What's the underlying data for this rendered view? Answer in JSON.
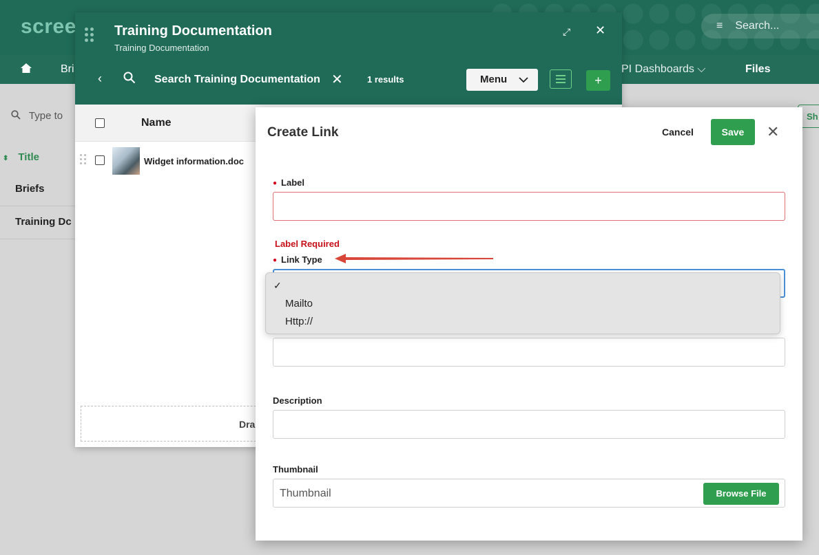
{
  "background": {
    "logo": "scree",
    "search_placeholder": "Search...",
    "nav": {
      "home_icon": "home-icon",
      "bri": "Bri",
      "kpi": "PI Dashboards",
      "files": "Files"
    },
    "filter_placeholder": "Type to",
    "show_button": "Sh",
    "column_title": "Title",
    "rows": [
      "Briefs",
      "Training Dc"
    ]
  },
  "window": {
    "title": "Training Documentation",
    "subtitle": "Training Documentation",
    "search_text": "Search Training Documentation",
    "results": "1 results",
    "menu_label": "Menu",
    "column_name": "Name",
    "file_name": "Widget information.doc",
    "drop_text": "Dra"
  },
  "dialog": {
    "title": "Create Link",
    "cancel_label": "Cancel",
    "save_label": "Save",
    "label_field": "Label",
    "label_error": "Label Required",
    "link_type_field": "Link Type",
    "link_type_options": [
      "Mailto",
      "Http://"
    ],
    "description_field": "Description",
    "thumbnail_field": "Thumbnail",
    "thumbnail_placeholder": "Thumbnail",
    "browse_label": "Browse File"
  },
  "colors": {
    "header_green": "#1f6b57",
    "action_green": "#2f9e4e",
    "error_red": "#c8101a",
    "annotation_arrow": "#d9473a"
  }
}
